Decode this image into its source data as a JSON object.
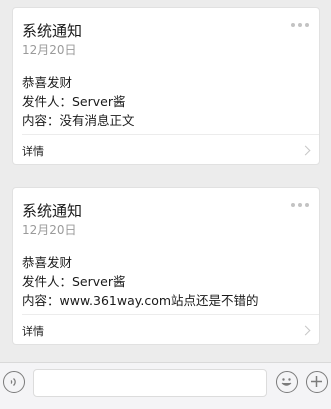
{
  "messages": [
    {
      "title": "系统通知",
      "date": "12月20日",
      "lines": [
        "恭喜发财",
        "发件人：Server酱",
        "内容：没有消息正文"
      ],
      "details_label": "详情"
    },
    {
      "title": "系统通知",
      "date": "12月20日",
      "lines": [
        "恭喜发财",
        "发件人：Server酱",
        "内容：www.361way.com站点还是不错的"
      ],
      "details_label": "详情"
    }
  ],
  "input_bar": {
    "text_value": "",
    "voice_icon": "voice-icon",
    "emoji_icon": "emoji-icon",
    "plus_icon": "plus-icon"
  },
  "colors": {
    "background": "#ececec",
    "card": "#ffffff",
    "secondary_text": "#9a9a9a",
    "icon_gray": "#7b7b7b"
  }
}
